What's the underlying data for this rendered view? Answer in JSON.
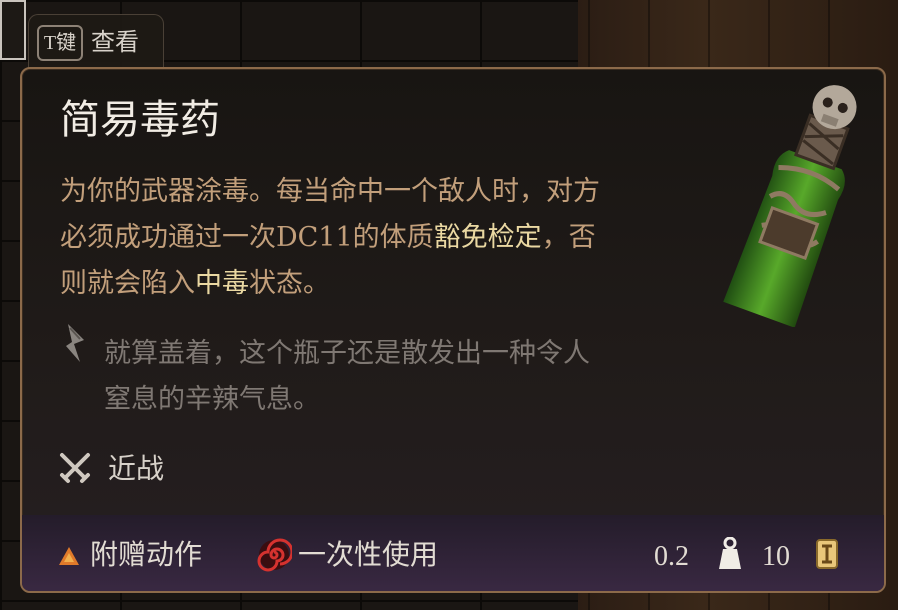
{
  "hint": {
    "key": "T键",
    "label": "查看"
  },
  "item": {
    "name": "简易毒药",
    "description": {
      "part1": "为你的武器涂毒。每当命中一个敌人时，对方必须成功通过一次DC11的体质",
      "link1": "豁免检定",
      "part2": "，否则就会陷入",
      "link2": "中毒",
      "part3": "状态。"
    },
    "flavor": "就算盖着，这个瓶子还是散发出一种令人窒息的辛辣气息。",
    "property": "近战"
  },
  "footer": {
    "action_type": "附赠动作",
    "usage": "一次性使用",
    "weight": "0.2",
    "value": "10"
  },
  "icons": {
    "flavor": "quill-icon",
    "property": "crossed-daggers-icon",
    "action": "bonus-action-triangle-icon",
    "usage": "spiral-icon",
    "weight": "weight-icon",
    "value": "gold-coin-icon"
  },
  "colors": {
    "description": "#c29f7b",
    "highlight": "#ead8a2",
    "flavor": "#7f7873",
    "border": "#8c6a4a",
    "bonus_action": "#e07a2a",
    "footer_bg": "#3a2943"
  }
}
